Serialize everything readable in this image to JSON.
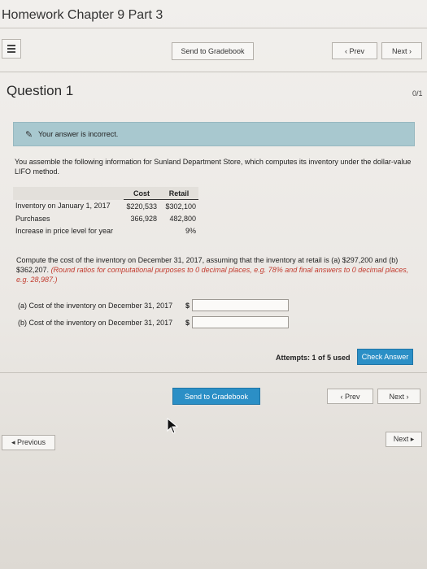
{
  "header": {
    "title": "Homework Chapter 9 Part 3"
  },
  "toolbar": {
    "send_label": "Send to Gradebook",
    "prev_label": "‹ Prev",
    "next_label": "Next ›"
  },
  "question": {
    "title": "Question 1",
    "score": "0/1",
    "alert": "Your answer is incorrect.",
    "prompt": "You assemble the following information for Sunland Department Store, which computes its inventory under the dollar-value LIFO method.",
    "table": {
      "headers": [
        "",
        "Cost",
        "Retail"
      ],
      "rows": [
        [
          "Inventory on January 1, 2017",
          "$220,533",
          "$302,100"
        ],
        [
          "Purchases",
          "366,928",
          "482,800"
        ],
        [
          "Increase in price level for year",
          "",
          "9%"
        ]
      ]
    },
    "compute_main": "Compute the cost of the inventory on December 31, 2017, assuming that the inventory at retail is (a) $297,200 and (b) $362,207.",
    "compute_note": "(Round ratios for computational purposes to 0 decimal places, e.g. 78% and final answers to 0 decimal places, e.g. 28,987.)",
    "answers": [
      {
        "label": "(a)  Cost of the inventory on December 31, 2017",
        "currency": "$",
        "value": ""
      },
      {
        "label": "(b)  Cost of the inventory on December 31, 2017",
        "currency": "$",
        "value": ""
      }
    ],
    "attempts": "Attempts: 1 of 5 used",
    "check_label": "Check Answer"
  },
  "footer": {
    "send_label": "Send to Gradebook",
    "prev_label": "‹ Prev",
    "next_label": "Next ›",
    "previous_label": "◂ Previous",
    "next_page_label": "Next ▸"
  },
  "colors": {
    "accent": "#2b8fc6",
    "alert_bg": "#a8c8cf",
    "note_red": "#c23b2e"
  }
}
